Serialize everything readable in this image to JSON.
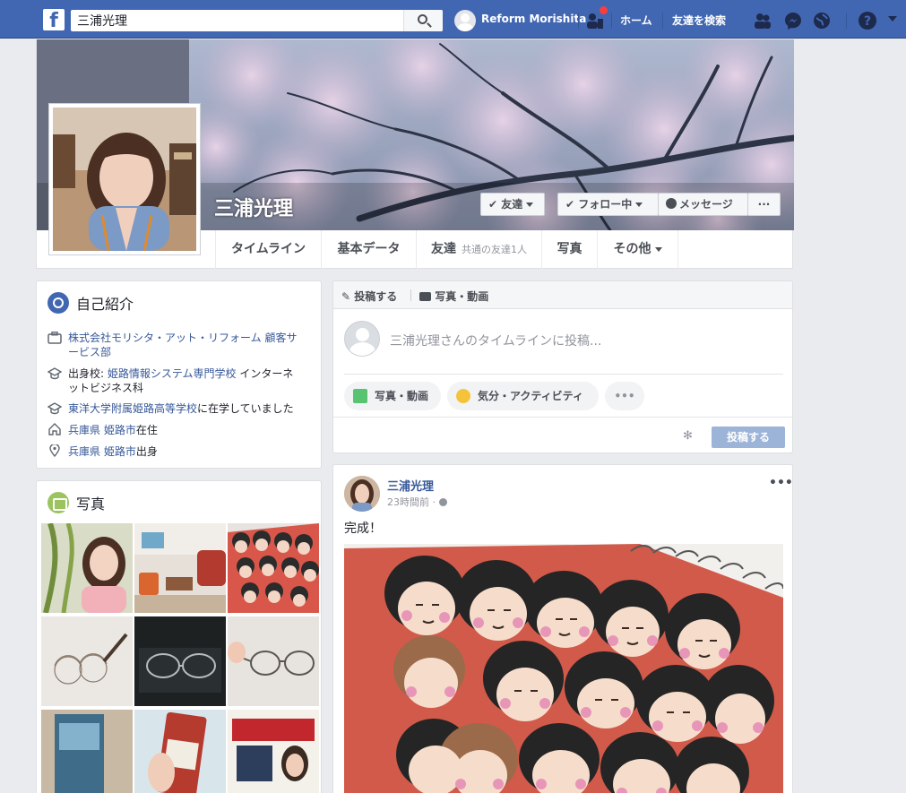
{
  "topbar": {
    "search_value": "三浦光理",
    "user_name": "Reform Morishita",
    "home": "ホーム",
    "find_friends": "友達を検索",
    "colors": {
      "bar": "#4267b2",
      "badge": "#fa3e3e"
    }
  },
  "profile": {
    "name": "三浦光理",
    "btn_friend": "友達",
    "btn_follow": "フォロー中",
    "btn_message": "メッセージ",
    "btn_more": "···"
  },
  "tabs": {
    "timeline": "タイムライン",
    "about": "基本データ",
    "friends": "友達",
    "friends_sub": "共通の友達1人",
    "photos": "写真",
    "more": "その他"
  },
  "intro": {
    "title": "自己紹介",
    "work_company": "株式会社モリシタ・アット・リフォーム",
    "work_role": "顧客サービス部",
    "school1_prefix": "出身校:",
    "school1_name": "姫路情報システム専門学校",
    "school1_dept": "インターネットビジネス科",
    "school2_name": "東洋大学附属姫路高等学校",
    "school2_suffix": "に在学していました",
    "lives_pref": "兵庫県",
    "lives_city": "姫路市",
    "lives_suffix": "在住",
    "from_pref": "兵庫県",
    "from_city": "姫路市",
    "from_suffix": "出身"
  },
  "photos": {
    "title": "写真"
  },
  "composer": {
    "tab_post": "投稿する",
    "tab_photo": "写真・動画",
    "placeholder": "三浦光理さんのタイムラインに投稿...",
    "pill_photo": "写真・動画",
    "pill_feeling": "気分・アクティビティ",
    "pill_more": "•••",
    "post_button": "投稿する"
  },
  "post": {
    "author": "三浦光理",
    "time": "23時間前 · ",
    "text": "完成！",
    "more": "•••"
  }
}
